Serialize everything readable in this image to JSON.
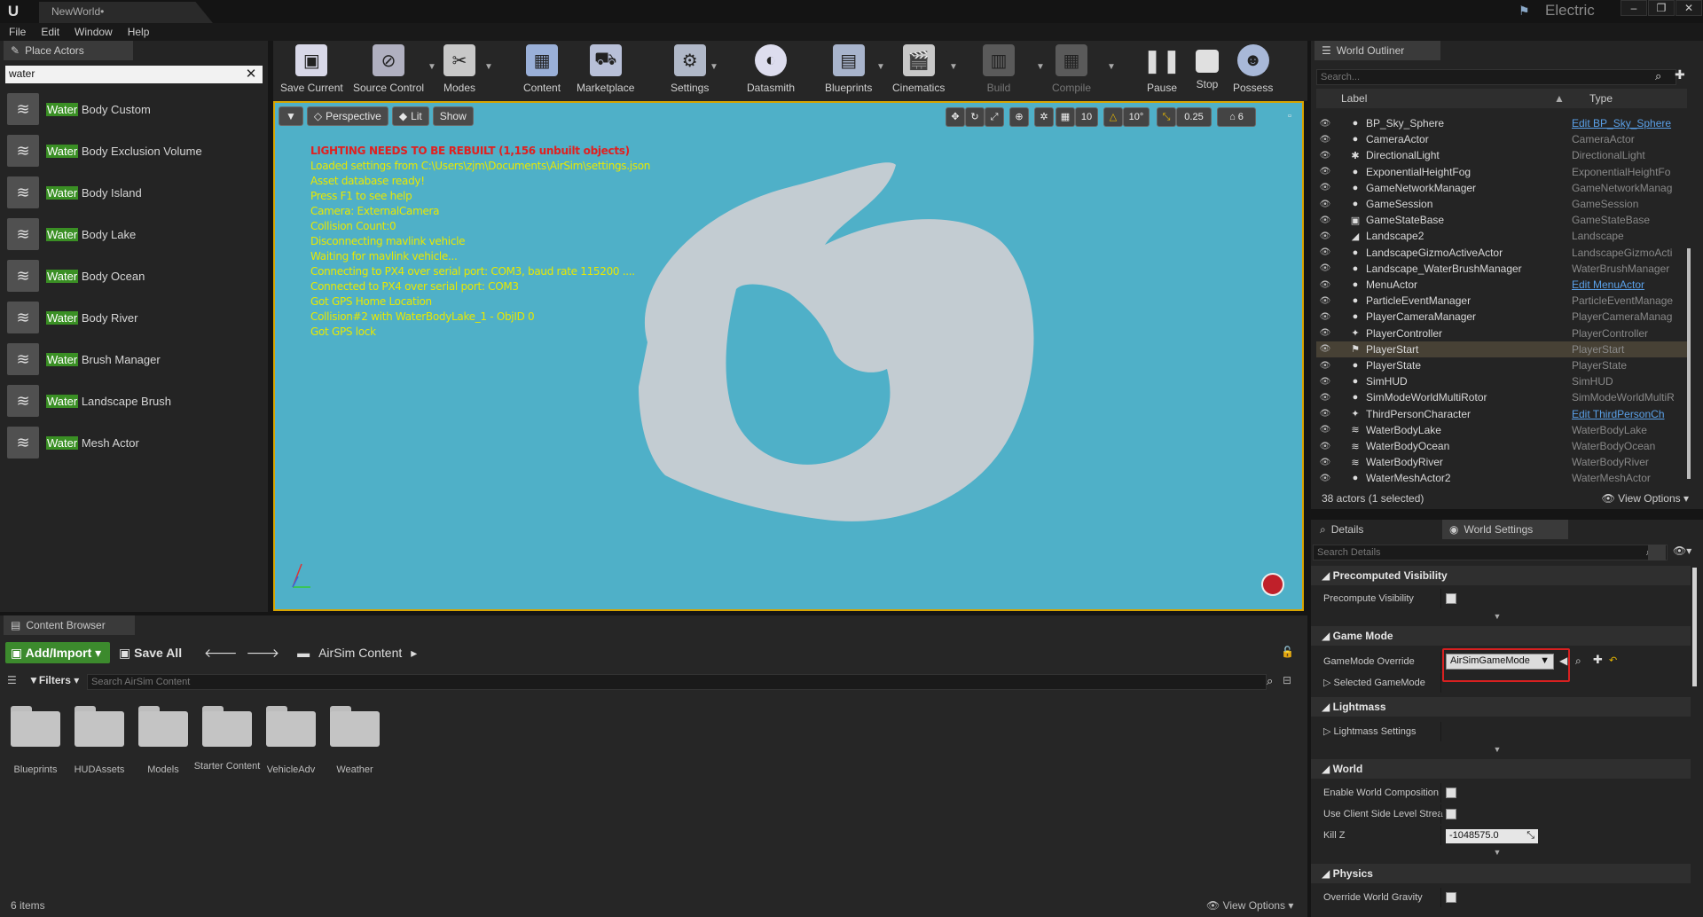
{
  "title_bar": {
    "tab": "NewWorld•",
    "theme_label": "Electric"
  },
  "menu": [
    "File",
    "Edit",
    "Window",
    "Help"
  ],
  "place_actors": {
    "tab": "Place Actors",
    "search": "water",
    "items": [
      {
        "hl": "Water",
        "rest": " Body Custom"
      },
      {
        "hl": "Water",
        "rest": " Body Exclusion Volume"
      },
      {
        "hl": "Water",
        "rest": " Body Island"
      },
      {
        "hl": "Water",
        "rest": " Body Lake"
      },
      {
        "hl": "Water",
        "rest": " Body Ocean"
      },
      {
        "hl": "Water",
        "rest": " Body River"
      },
      {
        "hl": "Water",
        "rest": " Brush Manager"
      },
      {
        "hl": "Water",
        "rest": " Landscape Brush"
      },
      {
        "hl": "Water",
        "rest": " Mesh Actor"
      }
    ]
  },
  "toolbar": {
    "save_current": "Save Current",
    "source_control": "Source Control",
    "modes": "Modes",
    "content": "Content",
    "marketplace": "Marketplace",
    "settings": "Settings",
    "datasmith": "Datasmith",
    "blueprints": "Blueprints",
    "cinematics": "Cinematics",
    "build": "Build",
    "compile": "Compile",
    "pause": "Pause",
    "stop": "Stop",
    "possess": "Possess"
  },
  "viewport": {
    "perspective": "Perspective",
    "lit": "Lit",
    "show": "Show",
    "grid_snap": "10",
    "rot_snap": "10°",
    "scale_snap": "0.25",
    "cam_speed": "6",
    "log": [
      "LIGHTING NEEDS TO BE REBUILT (1,156 unbuilt objects)",
      "Loaded settings from C:\\Users\\zjm\\Documents\\AirSim\\settings.json",
      "Asset database ready!",
      "Press F1 to see help",
      "Camera: ExternalCamera",
      "Collision Count:0",
      "Disconnecting mavlink vehicle",
      "Waiting for mavlink vehicle...",
      "Connecting to PX4 over serial port: COM3, baud rate 115200 ....",
      "Connected to PX4 over serial port: COM3",
      "Got GPS Home Location",
      "Collision#2 with WaterBodyLake_1 - ObjID 0",
      "Got GPS lock"
    ]
  },
  "outliner": {
    "tab": "World Outliner",
    "search_placeholder": "Search...",
    "col_label": "Label",
    "col_type": "Type",
    "rows": [
      {
        "label": "BP_Sky_Sphere",
        "type": "Edit BP_Sky_Sphere",
        "link": true,
        "icon": "●"
      },
      {
        "label": "CameraActor",
        "type": "CameraActor",
        "icon": "●"
      },
      {
        "label": "DirectionalLight",
        "type": "DirectionalLight",
        "icon": "✱"
      },
      {
        "label": "ExponentialHeightFog",
        "type": "ExponentialHeightFo",
        "icon": "●"
      },
      {
        "label": "GameNetworkManager",
        "type": "GameNetworkManag",
        "icon": "●"
      },
      {
        "label": "GameSession",
        "type": "GameSession",
        "icon": "●"
      },
      {
        "label": "GameStateBase",
        "type": "GameStateBase",
        "icon": "▣"
      },
      {
        "label": "Landscape2",
        "type": "Landscape",
        "icon": "◢"
      },
      {
        "label": "LandscapeGizmoActiveActor",
        "type": "LandscapeGizmoActi",
        "icon": "●"
      },
      {
        "label": "Landscape_WaterBrushManager",
        "type": "WaterBrushManager",
        "icon": "●"
      },
      {
        "label": "MenuActor",
        "type": "Edit MenuActor",
        "link": true,
        "icon": "●"
      },
      {
        "label": "ParticleEventManager",
        "type": "ParticleEventManage",
        "icon": "●"
      },
      {
        "label": "PlayerCameraManager",
        "type": "PlayerCameraManag",
        "icon": "●"
      },
      {
        "label": "PlayerController",
        "type": "PlayerController",
        "icon": "✦"
      },
      {
        "label": "PlayerStart",
        "type": "PlayerStart",
        "icon": "⚑",
        "sel": true
      },
      {
        "label": "PlayerState",
        "type": "PlayerState",
        "icon": "●"
      },
      {
        "label": "SimHUD",
        "type": "SimHUD",
        "icon": "●"
      },
      {
        "label": "SimModeWorldMultiRotor",
        "type": "SimModeWorldMultiR",
        "icon": "●"
      },
      {
        "label": "ThirdPersonCharacter",
        "type": "Edit ThirdPersonCh",
        "link": true,
        "icon": "✦"
      },
      {
        "label": "WaterBodyLake",
        "type": "WaterBodyLake",
        "icon": "≋"
      },
      {
        "label": "WaterBodyOcean",
        "type": "WaterBodyOcean",
        "icon": "≋"
      },
      {
        "label": "WaterBodyRiver",
        "type": "WaterBodyRiver",
        "icon": "≋"
      },
      {
        "label": "WaterMeshActor2",
        "type": "WaterMeshActor",
        "icon": "●"
      }
    ],
    "footer_count": "38 actors (1 selected)",
    "view_options": "View Options"
  },
  "details": {
    "tab_details": "Details",
    "tab_world": "World Settings",
    "search_placeholder": "Search Details",
    "sections": {
      "precomputed": "Precomputed Visibility",
      "precompute_vis": "Precompute Visibility",
      "game_mode": "Game Mode",
      "gm_override": "GameMode Override",
      "gm_value": "AirSimGameMode",
      "selected_gm": "Selected GameMode",
      "lightmass": "Lightmass",
      "lightmass_settings": "Lightmass Settings",
      "world": "World",
      "enable_wc": "Enable World Composition",
      "client_side": "Use Client Side Level Strea",
      "kill_z": "Kill Z",
      "kill_z_value": "-1048575.0",
      "physics": "Physics",
      "override_gravity": "Override World Gravity"
    }
  },
  "content_browser": {
    "tab": "Content Browser",
    "add_import": "Add/Import",
    "save_all": "Save All",
    "path": "AirSim Content",
    "filters": "Filters",
    "search_placeholder": "Search AirSim Content",
    "folders": [
      "Blueprints",
      "HUDAssets",
      "Models",
      "Starter Content",
      "VehicleAdv",
      "Weather"
    ],
    "count": "6 items",
    "view_options": "View Options"
  }
}
